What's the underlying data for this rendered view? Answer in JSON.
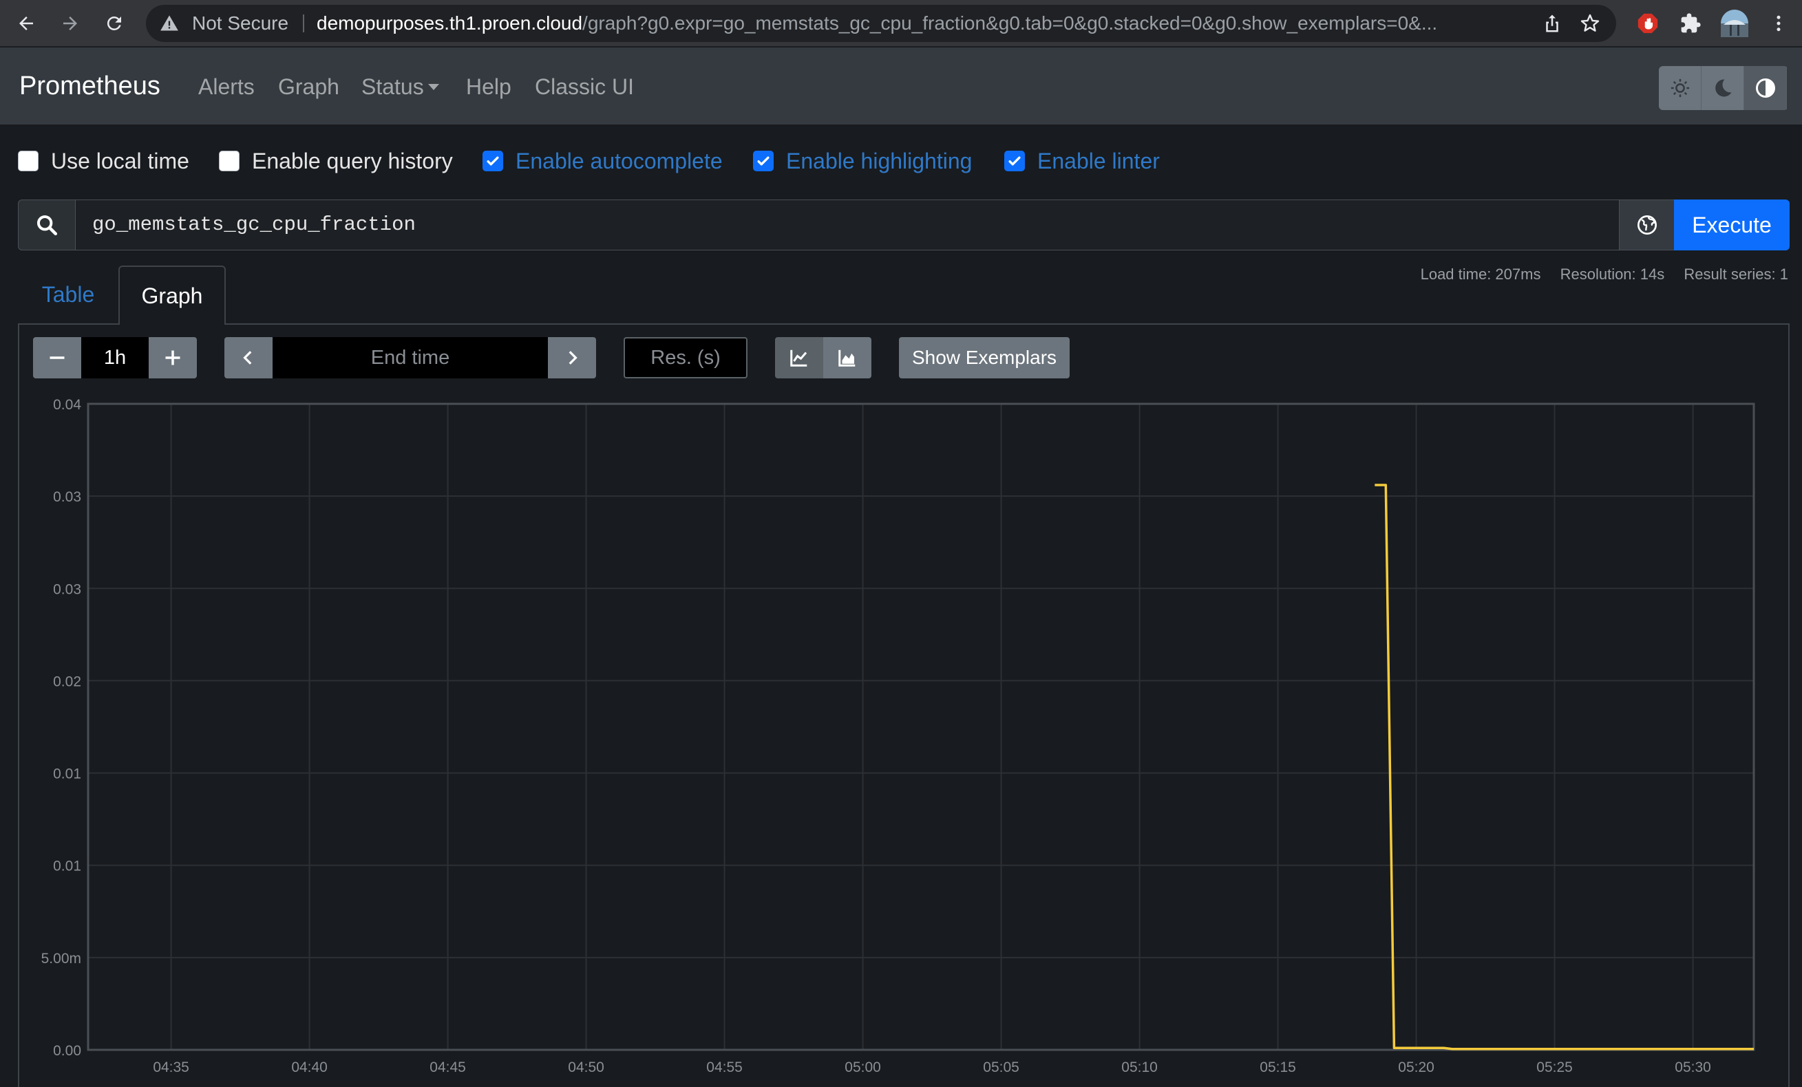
{
  "browser": {
    "security_label": "Not Secure",
    "url_host": "demopurposes.th1.proen.cloud",
    "url_rest": "/graph?g0.expr=go_memstats_gc_cpu_fraction&g0.tab=0&g0.stacked=0&g0.show_exemplars=0&..."
  },
  "navbar": {
    "brand": "Prometheus",
    "links": [
      "Alerts",
      "Graph",
      "Status",
      "Help",
      "Classic UI"
    ]
  },
  "options": [
    {
      "label": "Use local time",
      "checked": false
    },
    {
      "label": "Enable query history",
      "checked": false
    },
    {
      "label": "Enable autocomplete",
      "checked": true
    },
    {
      "label": "Enable highlighting",
      "checked": true
    },
    {
      "label": "Enable linter",
      "checked": true
    }
  ],
  "query": {
    "expression": "go_memstats_gc_cpu_fraction",
    "execute_label": "Execute"
  },
  "tabs": {
    "table": "Table",
    "graph": "Graph",
    "active": "Graph"
  },
  "stats": {
    "load_time": "Load time: 207ms",
    "resolution": "Resolution: 14s",
    "result_series": "Result series: 1"
  },
  "controls": {
    "range": "1h",
    "end_time_placeholder": "End time",
    "resolution_placeholder": "Res. (s)",
    "exemplars_label": "Show Exemplars"
  },
  "colors": {
    "series": "#f4cb3c",
    "accent": "#0d6efd",
    "link_active": "#2f79c9"
  },
  "chart_data": {
    "type": "line",
    "ytick_labels": [
      "0.00",
      "5.00m",
      "0.01",
      "0.01",
      "0.02",
      "0.03",
      "0.03",
      "0.04"
    ],
    "ylim": [
      0,
      0.035
    ],
    "xtick_labels": [
      "04:35",
      "04:40",
      "04:45",
      "04:50",
      "04:55",
      "05:00",
      "05:05",
      "05:10",
      "05:15",
      "05:20",
      "05:25",
      "05:30"
    ],
    "xlim_minutes_past_0430": [
      2.0,
      62.2
    ],
    "series": [
      {
        "x_minutes_past_0430": [
          48.5,
          48.9,
          49.2,
          49.3,
          51.0,
          51.3,
          62.2
        ],
        "values": [
          0.0306,
          0.0306,
          0.0001,
          0.0001,
          0.0001,
          5e-05,
          5e-05
        ]
      }
    ]
  }
}
